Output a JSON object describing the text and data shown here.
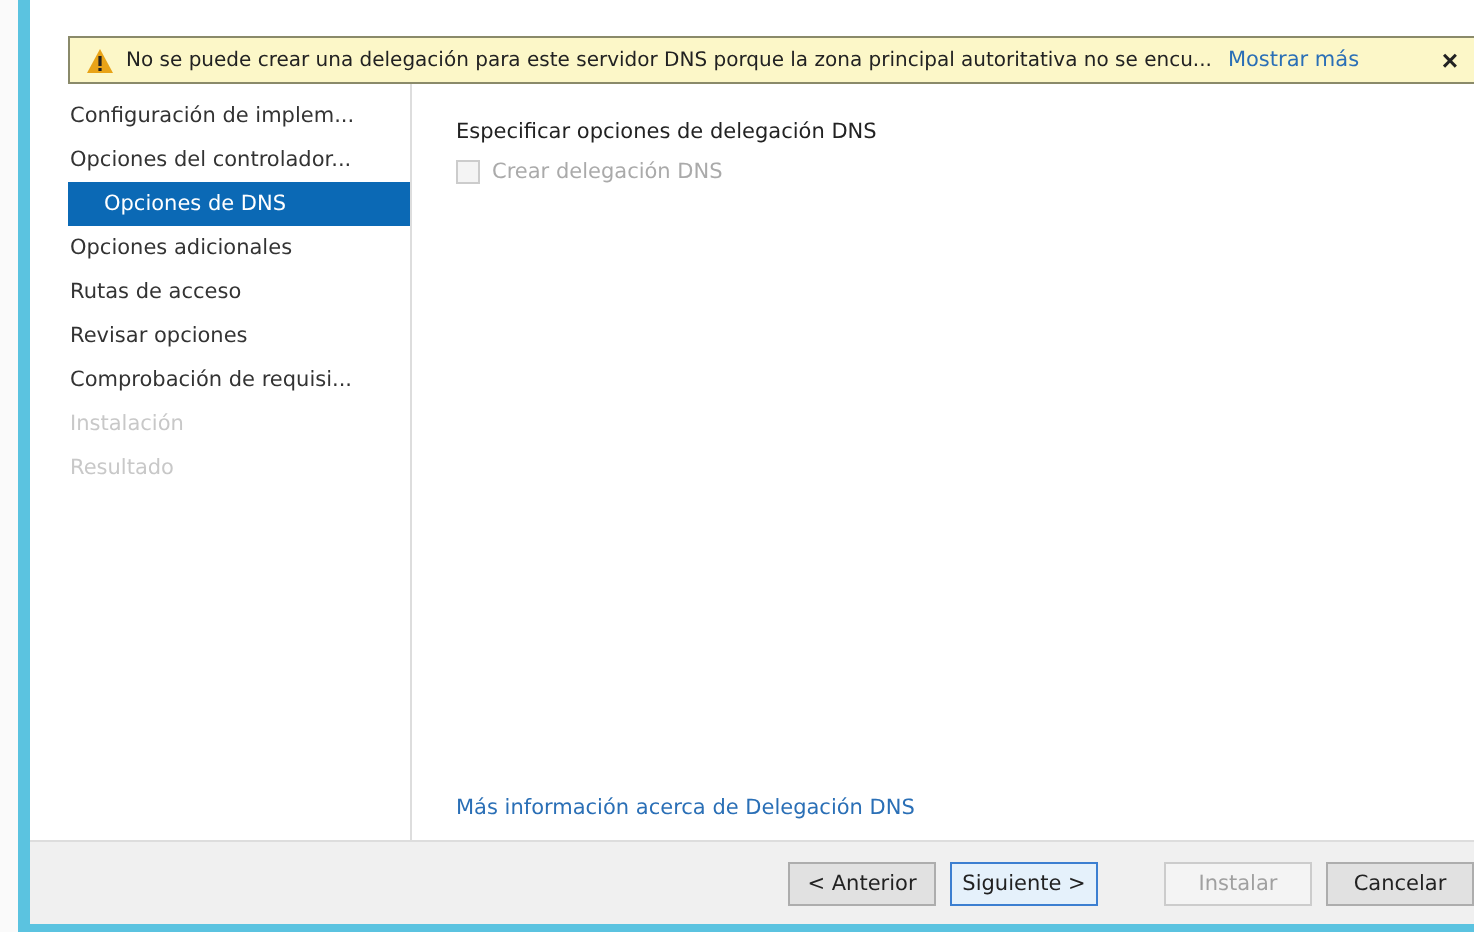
{
  "banner": {
    "message": "No se puede crear una delegación para este servidor DNS porque la zona principal autoritativa no se encu...",
    "link": "Mostrar más",
    "close": "×"
  },
  "sidebar": {
    "items": [
      {
        "label": "Configuración de implem...",
        "selected": false,
        "disabled": false,
        "indented": false
      },
      {
        "label": "Opciones del controlador...",
        "selected": false,
        "disabled": false,
        "indented": false
      },
      {
        "label": "Opciones de DNS",
        "selected": true,
        "disabled": false,
        "indented": true
      },
      {
        "label": "Opciones adicionales",
        "selected": false,
        "disabled": false,
        "indented": false
      },
      {
        "label": "Rutas de acceso",
        "selected": false,
        "disabled": false,
        "indented": false
      },
      {
        "label": "Revisar opciones",
        "selected": false,
        "disabled": false,
        "indented": false
      },
      {
        "label": "Comprobación de requisi...",
        "selected": false,
        "disabled": false,
        "indented": false
      },
      {
        "label": "Instalación",
        "selected": false,
        "disabled": true,
        "indented": false
      },
      {
        "label": "Resultado",
        "selected": false,
        "disabled": true,
        "indented": false
      }
    ]
  },
  "content": {
    "heading": "Especificar opciones de delegación DNS",
    "checkbox": {
      "label": "Crear delegación DNS",
      "checked": false,
      "disabled": true
    },
    "link": "Más información acerca de Delegación DNS"
  },
  "buttons": [
    {
      "label": "< Anterior",
      "disabled": false,
      "focused": false
    },
    {
      "label": "Siguiente >",
      "disabled": false,
      "focused": true
    },
    {
      "label": "Instalar",
      "disabled": true,
      "focused": false
    },
    {
      "label": "Cancelar",
      "disabled": false,
      "focused": false
    }
  ]
}
